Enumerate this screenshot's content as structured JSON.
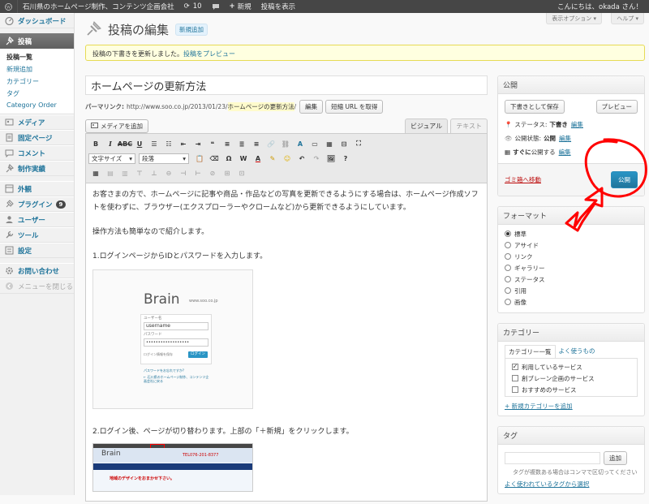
{
  "adminbar": {
    "site_name": "石川県のホームページ制作、コンテンツ企画会社",
    "updates_count": "10",
    "new_label": "新規",
    "view_post_label": "投稿を表示",
    "greeting": "こんにちは、okada さん！"
  },
  "sidebar": {
    "dashboard": "ダッシュボード",
    "posts": "投稿",
    "posts_sub": [
      "投稿一覧",
      "新規追加",
      "カテゴリー",
      "タグ",
      "Category Order"
    ],
    "media": "メディア",
    "pages": "固定ページ",
    "comments": "コメント",
    "works": "制作実績",
    "appearance": "外観",
    "plugins": "プラグイン",
    "plugins_badge": "9",
    "users": "ユーザー",
    "tools": "ツール",
    "settings": "設定",
    "contact": "お問い合わせ",
    "collapse": "メニューを閉じる"
  },
  "header": {
    "title": "投稿の編集",
    "add_new": "新規追加",
    "screen_options": "表示オプション ▾",
    "help": "ヘルプ ▾"
  },
  "notice": {
    "text": "投稿の下書きを更新しました。",
    "link": "投稿をプレビュー"
  },
  "editor": {
    "post_title": "ホームページの更新方法",
    "permalink_label": "パーマリンク:",
    "permalink_base": "http://www.soo.co.jp/2013/01/23/",
    "permalink_slug": "ホームページの更新方法",
    "permalink_tail": "/",
    "edit_button": "編集",
    "shortlink_button": "短縮 URL を取得",
    "add_media": "メディアを追加",
    "tab_visual": "ビジュアル",
    "tab_text": "テキスト",
    "font_size_select": "文字サイズ",
    "format_select": "段落",
    "paragraph1": "お客さまの方で、ホームページに記事や商品・作品などの写真を更新できるようにする場合は、ホームページ作成ソフトを使わずに、ブラウザー(エクスプローラーやクロームなど)から更新できるようにしています。",
    "paragraph2": "操作方法も簡単なので紹介します。",
    "paragraph3": "1.ログインページからIDとパスワードを入力します。",
    "paragraph4": "2.ログイン後、ページが切り替わります。上部の「＋新規」をクリックします。",
    "shot1": {
      "logo": "Brain",
      "url": "www.soo.co.jp",
      "user_label": "ユーザー名",
      "user_value": "username",
      "pass_label": "パスワード",
      "pass_value": "••••••••••••••••••",
      "remember": "ログイン情報を保存",
      "login_btn": "ログイン",
      "lost_pw": "パスワードをお忘れですか?",
      "back_link": "← 石川県のホームページ制作、コンテンツ企画会社に戻る"
    },
    "shot2": {
      "logo": "Brain",
      "phone": "TEL076-201-8377",
      "headline": "地域のデザインをおまかせ下さい。"
    }
  },
  "publish_box": {
    "title": "公開",
    "save_draft": "下書きとして保存",
    "preview": "プレビュー",
    "status_label": "ステータス:",
    "status_value": "下書き",
    "visibility_label": "公開状態:",
    "visibility_value": "公開",
    "schedule_label": "すぐに",
    "schedule_suffix": "公開する",
    "edit_link": "編集",
    "trash": "ゴミ箱へ移動",
    "publish": "公開"
  },
  "format_box": {
    "title": "フォーマット",
    "options": [
      "標準",
      "アサイド",
      "リンク",
      "ギャラリー",
      "ステータス",
      "引用",
      "画像"
    ],
    "selected": "標準"
  },
  "category_box": {
    "title": "カテゴリー",
    "tab_all": "カテゴリー一覧",
    "tab_popular": "よく使うもの",
    "items": [
      {
        "label": "利用しているサービス",
        "checked": true
      },
      {
        "label": "創ブレーン企画のサービス",
        "checked": false
      },
      {
        "label": "おすすめのサービス",
        "checked": false
      }
    ],
    "add_link": "+ 新規カテゴリーを追加"
  },
  "tag_box": {
    "title": "タグ",
    "add_button": "追加",
    "hint": "タグが複数ある場合はコンマで区切ってください",
    "popular_link": "よく使われているタグから選択"
  },
  "colors": {
    "accent": "#21759b",
    "annotation": "#ff0000",
    "adminbar": "#464646"
  }
}
